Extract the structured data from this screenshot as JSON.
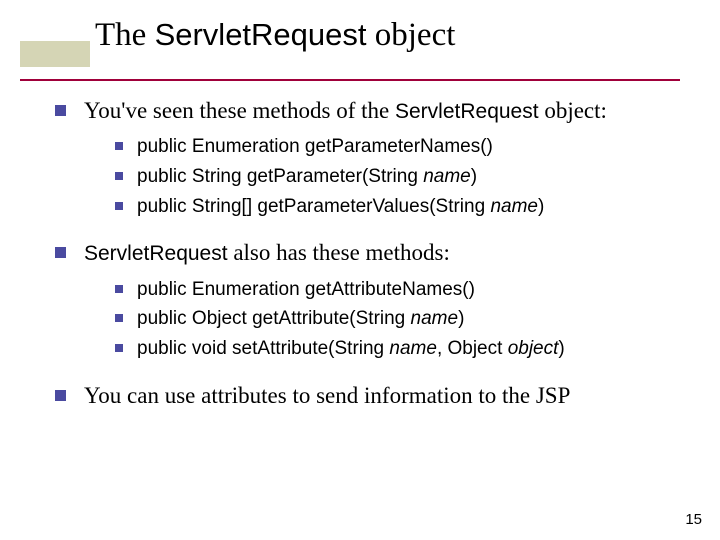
{
  "title": {
    "pre": "The ",
    "code": "ServletRequest",
    "post": " object"
  },
  "items": [
    {
      "text_parts": [
        {
          "t": "You've seen these methods of the ",
          "m": false
        },
        {
          "t": "ServletRequest",
          "m": true
        },
        {
          "t": " object:",
          "m": false
        }
      ],
      "sub": [
        [
          {
            "t": "public Enumeration getParameterNames()",
            "m": true
          }
        ],
        [
          {
            "t": "public String getParameter(String ",
            "m": true
          },
          {
            "t": "name",
            "m": true,
            "em": true
          },
          {
            "t": ")",
            "m": true
          }
        ],
        [
          {
            "t": "public String[] getParameterValues(String ",
            "m": true
          },
          {
            "t": "name",
            "m": true,
            "em": true
          },
          {
            "t": ")",
            "m": true
          }
        ]
      ]
    },
    {
      "text_parts": [
        {
          "t": "ServletRequest",
          "m": true
        },
        {
          "t": " also has these methods:",
          "m": false
        }
      ],
      "sub": [
        [
          {
            "t": "public Enumeration getAttributeNames()",
            "m": true
          }
        ],
        [
          {
            "t": "public Object getAttribute(String ",
            "m": true
          },
          {
            "t": "name",
            "m": true,
            "em": true
          },
          {
            "t": ")",
            "m": true
          }
        ],
        [
          {
            "t": "public void setAttribute(String ",
            "m": true
          },
          {
            "t": "name",
            "m": true,
            "em": true
          },
          {
            "t": ", Object ",
            "m": true
          },
          {
            "t": "object",
            "m": true,
            "em": true
          },
          {
            "t": ")",
            "m": true
          }
        ]
      ]
    },
    {
      "text_parts": [
        {
          "t": "You can use attributes to send information to the JSP",
          "m": false
        }
      ],
      "sub": []
    }
  ],
  "page_number": "15"
}
